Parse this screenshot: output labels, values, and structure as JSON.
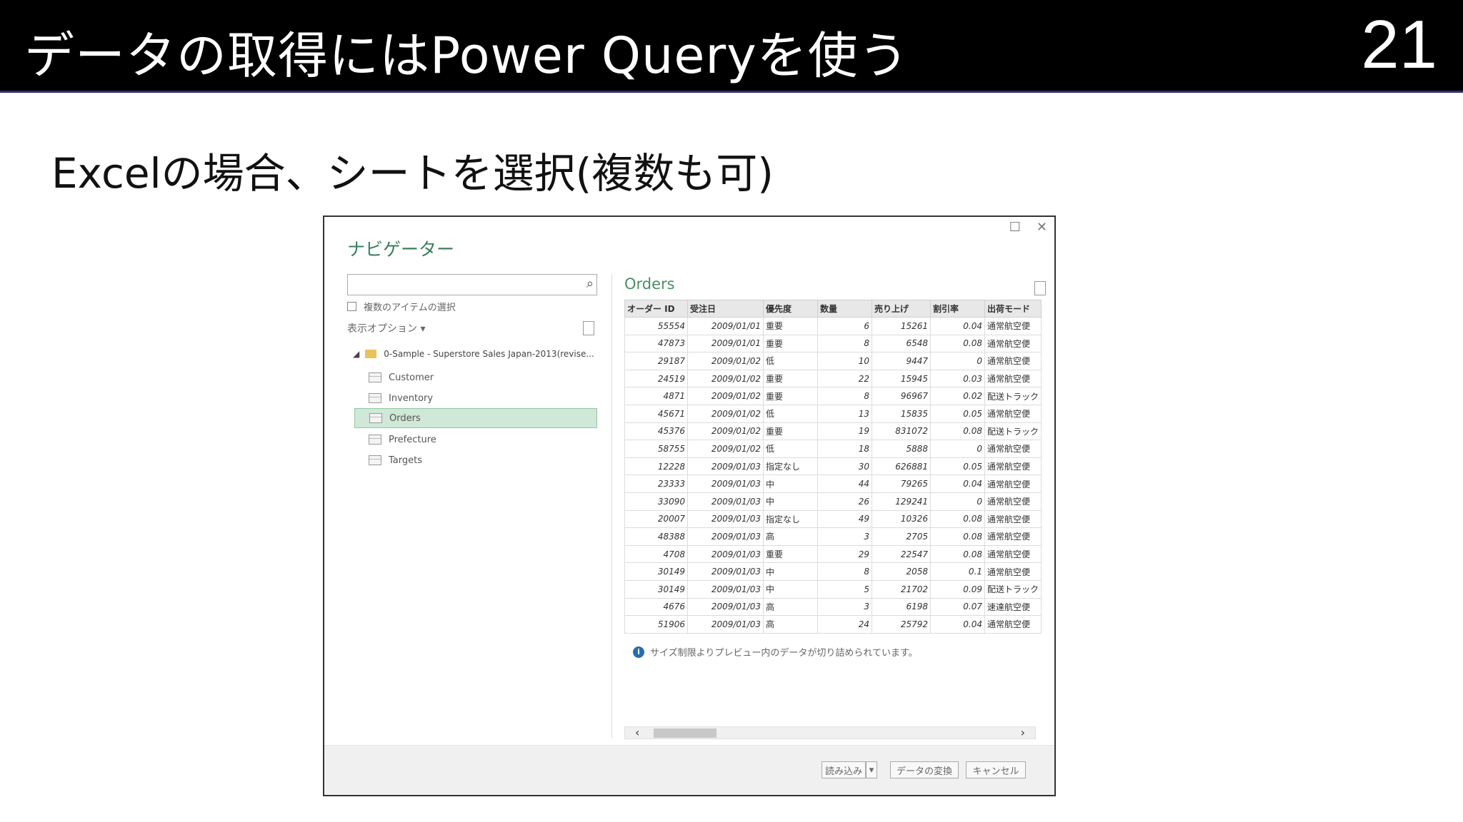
{
  "slide": {
    "title": "データの取得にはPower Queryを使う",
    "page_number": "21",
    "subtitle": "Excelの場合、シートを選択(複数も可)"
  },
  "dialog": {
    "title": "ナビゲーター",
    "search_placeholder": "",
    "multi_select_label": "複数のアイテムの選択",
    "display_options_label": "表示オプション ▾",
    "tree_root": "0-Sample - Superstore Sales Japan-2013(revise...",
    "tables": [
      "Customer",
      "Inventory",
      "Orders",
      "Prefecture",
      "Targets"
    ],
    "selected_table": "Orders",
    "preview_title": "Orders",
    "columns": [
      "オーダー ID",
      "受注日",
      "優先度",
      "数量",
      "売り上げ",
      "割引率",
      "出荷モード"
    ],
    "rows": [
      [
        "55554",
        "2009/01/01",
        "重要",
        "6",
        "15261",
        "0.04",
        "通常航空便"
      ],
      [
        "47873",
        "2009/01/01",
        "重要",
        "8",
        "6548",
        "0.08",
        "通常航空便"
      ],
      [
        "29187",
        "2009/01/02",
        "低",
        "10",
        "9447",
        "0",
        "通常航空便"
      ],
      [
        "24519",
        "2009/01/02",
        "重要",
        "22",
        "15945",
        "0.03",
        "通常航空便"
      ],
      [
        "4871",
        "2009/01/02",
        "重要",
        "8",
        "96967",
        "0.02",
        "配送トラック"
      ],
      [
        "45671",
        "2009/01/02",
        "低",
        "13",
        "15835",
        "0.05",
        "通常航空便"
      ],
      [
        "45376",
        "2009/01/02",
        "重要",
        "19",
        "831072",
        "0.08",
        "配送トラック"
      ],
      [
        "58755",
        "2009/01/02",
        "低",
        "18",
        "5888",
        "0",
        "通常航空便"
      ],
      [
        "12228",
        "2009/01/03",
        "指定なし",
        "30",
        "626881",
        "0.05",
        "通常航空便"
      ],
      [
        "23333",
        "2009/01/03",
        "中",
        "44",
        "79265",
        "0.04",
        "通常航空便"
      ],
      [
        "33090",
        "2009/01/03",
        "中",
        "26",
        "129241",
        "0",
        "通常航空便"
      ],
      [
        "20007",
        "2009/01/03",
        "指定なし",
        "49",
        "10326",
        "0.08",
        "通常航空便"
      ],
      [
        "48388",
        "2009/01/03",
        "高",
        "3",
        "2705",
        "0.08",
        "通常航空便"
      ],
      [
        "4708",
        "2009/01/03",
        "重要",
        "29",
        "22547",
        "0.08",
        "通常航空便"
      ],
      [
        "30149",
        "2009/01/03",
        "中",
        "8",
        "2058",
        "0.1",
        "通常航空便"
      ],
      [
        "30149",
        "2009/01/03",
        "中",
        "5",
        "21702",
        "0.09",
        "配送トラック"
      ],
      [
        "4676",
        "2009/01/03",
        "高",
        "3",
        "6198",
        "0.07",
        "速達航空便"
      ],
      [
        "51906",
        "2009/01/03",
        "高",
        "24",
        "25792",
        "0.04",
        "通常航空便"
      ]
    ],
    "info_text": "サイズ制限よりプレビュー内のデータが切り詰められています。",
    "buttons": {
      "load": "読み込み",
      "load_dropdown": "▾",
      "transform": "データの変換",
      "cancel": "キャンセル"
    }
  }
}
